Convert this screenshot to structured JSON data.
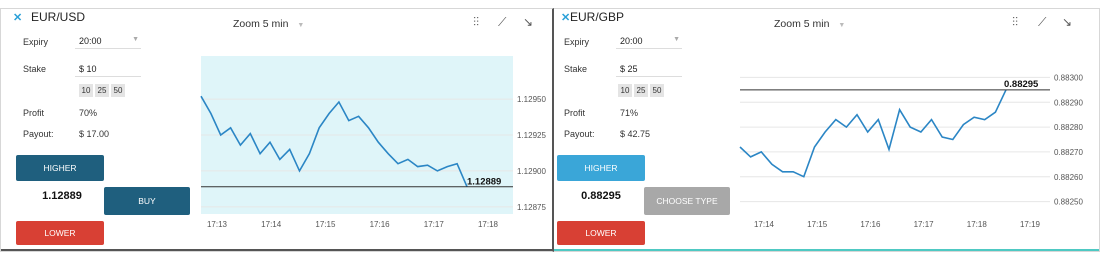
{
  "panels": [
    {
      "pair": "EUR/USD",
      "expiry_label": "Expiry",
      "expiry_value": "20:00",
      "stake_label": "Stake",
      "stake_value": "$  10",
      "chips": [
        "10",
        "25",
        "50"
      ],
      "profit_label": "Profit",
      "profit_value": "70%",
      "payout_label": "Payout:",
      "payout_value": "$ 17.00",
      "higher_label": "HIGHER",
      "lower_label": "LOWER",
      "current_rate": "1.12889",
      "action_label": "BUY",
      "zoom_label": "Zoom",
      "zoom_value": "5 min",
      "colors": {
        "higher": "#1f5f7e",
        "action": "#1f5f7e",
        "plot_bg": "#dff5f9",
        "line": "#2b86c5"
      },
      "chart_data": {
        "type": "line",
        "x_ticks": [
          "17:13",
          "17:14",
          "17:15",
          "17:16",
          "17:17",
          "17:18"
        ],
        "y_ticks": [
          "1.12950",
          "1.12925",
          "1.12900",
          "1.12875"
        ],
        "ylim": [
          1.1287,
          1.1298
        ],
        "price_label": "1.12889",
        "series": [
          {
            "values": [
              1.12952,
              1.1294,
              1.12925,
              1.1293,
              1.12918,
              1.12926,
              1.12912,
              1.1292,
              1.12908,
              1.12915,
              1.129,
              1.12912,
              1.1293,
              1.1294,
              1.12948,
              1.12935,
              1.12938,
              1.1293,
              1.1292,
              1.12912,
              1.12905,
              1.12908,
              1.12903,
              1.12904,
              1.129,
              1.12903,
              1.12905,
              1.12889
            ]
          }
        ],
        "grid": true
      }
    },
    {
      "pair": "EUR/GBP",
      "expiry_label": "Expiry",
      "expiry_value": "20:00",
      "stake_label": "Stake",
      "stake_value": "$  25",
      "chips": [
        "10",
        "25",
        "50"
      ],
      "profit_label": "Profit",
      "profit_value": "71%",
      "payout_label": "Payout:",
      "payout_value": "$ 42.75",
      "higher_label": "HIGHER",
      "lower_label": "LOWER",
      "current_rate": "0.88295",
      "action_label": "CHOOSE TYPE",
      "zoom_label": "Zoom",
      "zoom_value": "5 min",
      "colors": {
        "higher": "#3aa6d8",
        "action": "#a8a8a8",
        "plot_bg": "#ffffff",
        "line": "#2b86c5"
      },
      "chart_data": {
        "type": "line",
        "x_ticks": [
          "17:14",
          "17:15",
          "17:16",
          "17:17",
          "17:18",
          "17:19"
        ],
        "y_ticks": [
          "0.88300",
          "0.88290",
          "0.88280",
          "0.88270",
          "0.88260",
          "0.88250"
        ],
        "ylim": [
          0.88245,
          0.88305
        ],
        "price_label": "0.88295",
        "series": [
          {
            "values": [
              0.88272,
              0.88268,
              0.8827,
              0.88265,
              0.88262,
              0.88262,
              0.8826,
              0.88272,
              0.88278,
              0.88283,
              0.8828,
              0.88285,
              0.88278,
              0.88283,
              0.88271,
              0.88287,
              0.8828,
              0.88278,
              0.88283,
              0.88276,
              0.88275,
              0.88281,
              0.88284,
              0.88283,
              0.88286,
              0.88295
            ]
          }
        ],
        "grid": true
      }
    }
  ]
}
